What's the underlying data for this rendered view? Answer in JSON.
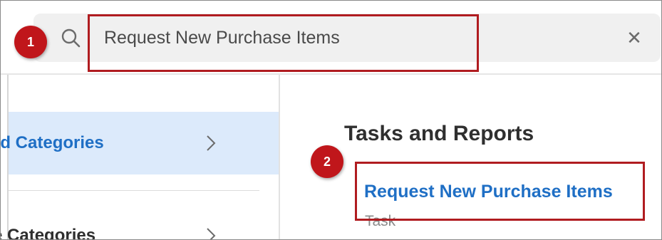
{
  "search": {
    "value": "Request New Purchase Items",
    "placeholder": "",
    "clear_icon": "close-icon",
    "search_icon": "search-icon"
  },
  "sidebar": {
    "items": [
      {
        "label": "ed Categories",
        "active": true,
        "icon": "chevron-right-icon"
      },
      {
        "label": "e Categories",
        "active": false,
        "icon": "chevron-right-icon"
      }
    ]
  },
  "results": {
    "heading": "Tasks and Reports",
    "items": [
      {
        "label": "Request New Purchase Items",
        "type": "Task"
      }
    ]
  },
  "annotations": {
    "step1": "1",
    "step2": "2",
    "highlight_color": "#b01c20",
    "badge_color": "#c0161b"
  },
  "colors": {
    "accent": "#1f6fc5",
    "active_bg": "#dceafb",
    "search_bg": "#f0f0f0"
  }
}
